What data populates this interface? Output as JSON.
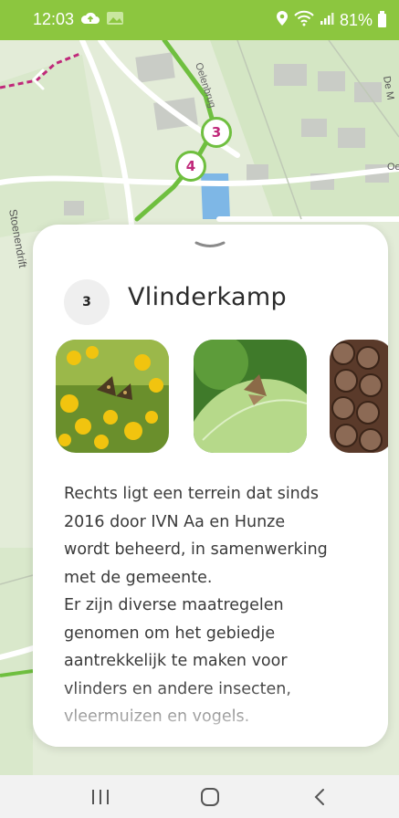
{
  "status_bar": {
    "time": "12:03",
    "battery": "81%"
  },
  "map": {
    "route_markers": [
      "3",
      "4"
    ],
    "street_labels": [
      "Oelenbrug",
      "Stoenendrift",
      "De M",
      "Oe"
    ]
  },
  "point": {
    "number": "3",
    "title": "Vlinderkamp",
    "description": "Rechts ligt een terrein dat sinds\n2016 door IVN Aa en Hunze\nwordt beheerd, in samenwerking\nmet de gemeente.\nEr zijn diverse maatregelen\ngenomen om het gebiedje\naantrekkelijk te maken voor\nvlinders en andere insecten,\nvleermuizen en vogels."
  },
  "photos": [
    {
      "icon": "butterfly-on-yellow-flowers"
    },
    {
      "icon": "butterfly-on-leaf"
    },
    {
      "icon": "insect-hotel"
    }
  ],
  "colors": {
    "status_bar": "#8cc63f",
    "route": "#6fbf3f",
    "marker_text": "#c0287a"
  }
}
